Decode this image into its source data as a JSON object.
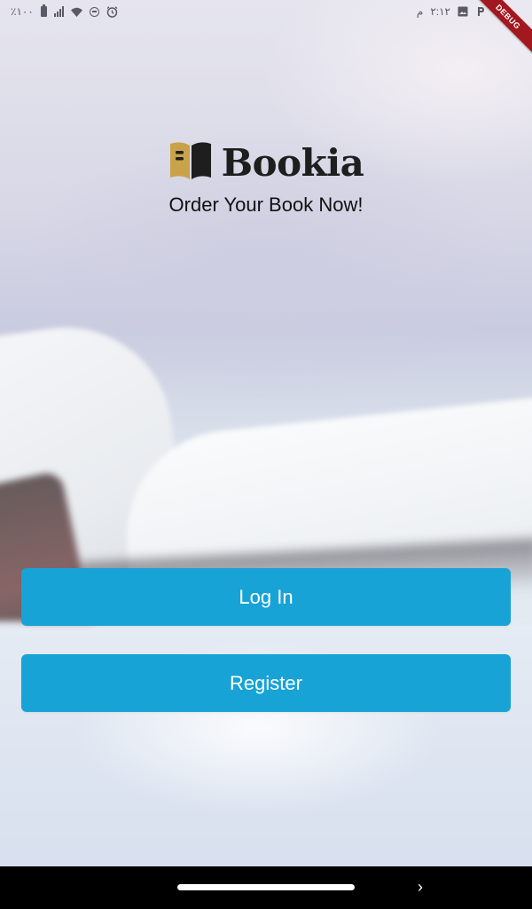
{
  "status_bar": {
    "battery_text": "٪١٠٠",
    "time": "٢:١٢",
    "time_suffix": "م"
  },
  "debug_label": "DEBUG",
  "app": {
    "name": "Bookia",
    "tagline": "Order Your Book Now!",
    "brand_icon": "open-book-icon",
    "colors": {
      "primary": "#17a3d6",
      "logo_gold": "#c9a24a",
      "logo_dark": "#1e1e1e"
    }
  },
  "actions": {
    "login_label": "Log In",
    "register_label": "Register"
  },
  "nav": {
    "back_glyph": "›"
  }
}
